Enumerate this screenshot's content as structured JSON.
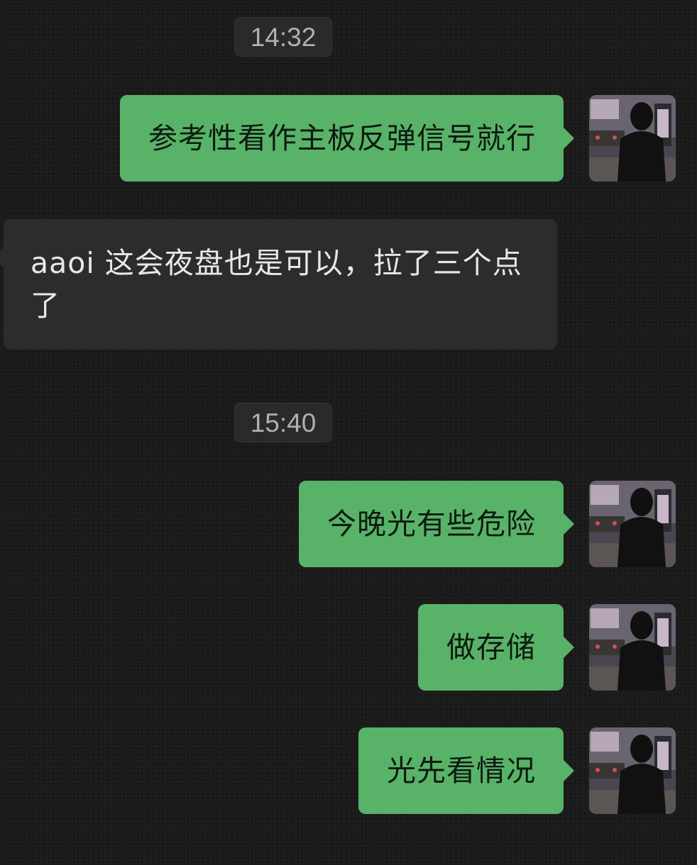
{
  "conversation": {
    "timestamps": [
      "14:32",
      "15:40"
    ],
    "messages": [
      {
        "direction": "outgoing",
        "text": "参考性看作主板反弹信号就行"
      },
      {
        "direction": "incoming",
        "text": "aaoi 这会夜盘也是可以，拉了三个点了"
      },
      {
        "direction": "outgoing",
        "text": "今晚光有些危险"
      },
      {
        "direction": "outgoing",
        "text": "做存储"
      },
      {
        "direction": "outgoing",
        "text": "光先看情况"
      }
    ]
  },
  "colors": {
    "background": "#1b1b1b",
    "outgoing_bubble": "#58b368",
    "incoming_bubble": "#2c2c2c",
    "timestamp_chip": "#2a2a2a"
  },
  "icons": {
    "avatar": "avatar-photo-person-in-hoodie"
  }
}
